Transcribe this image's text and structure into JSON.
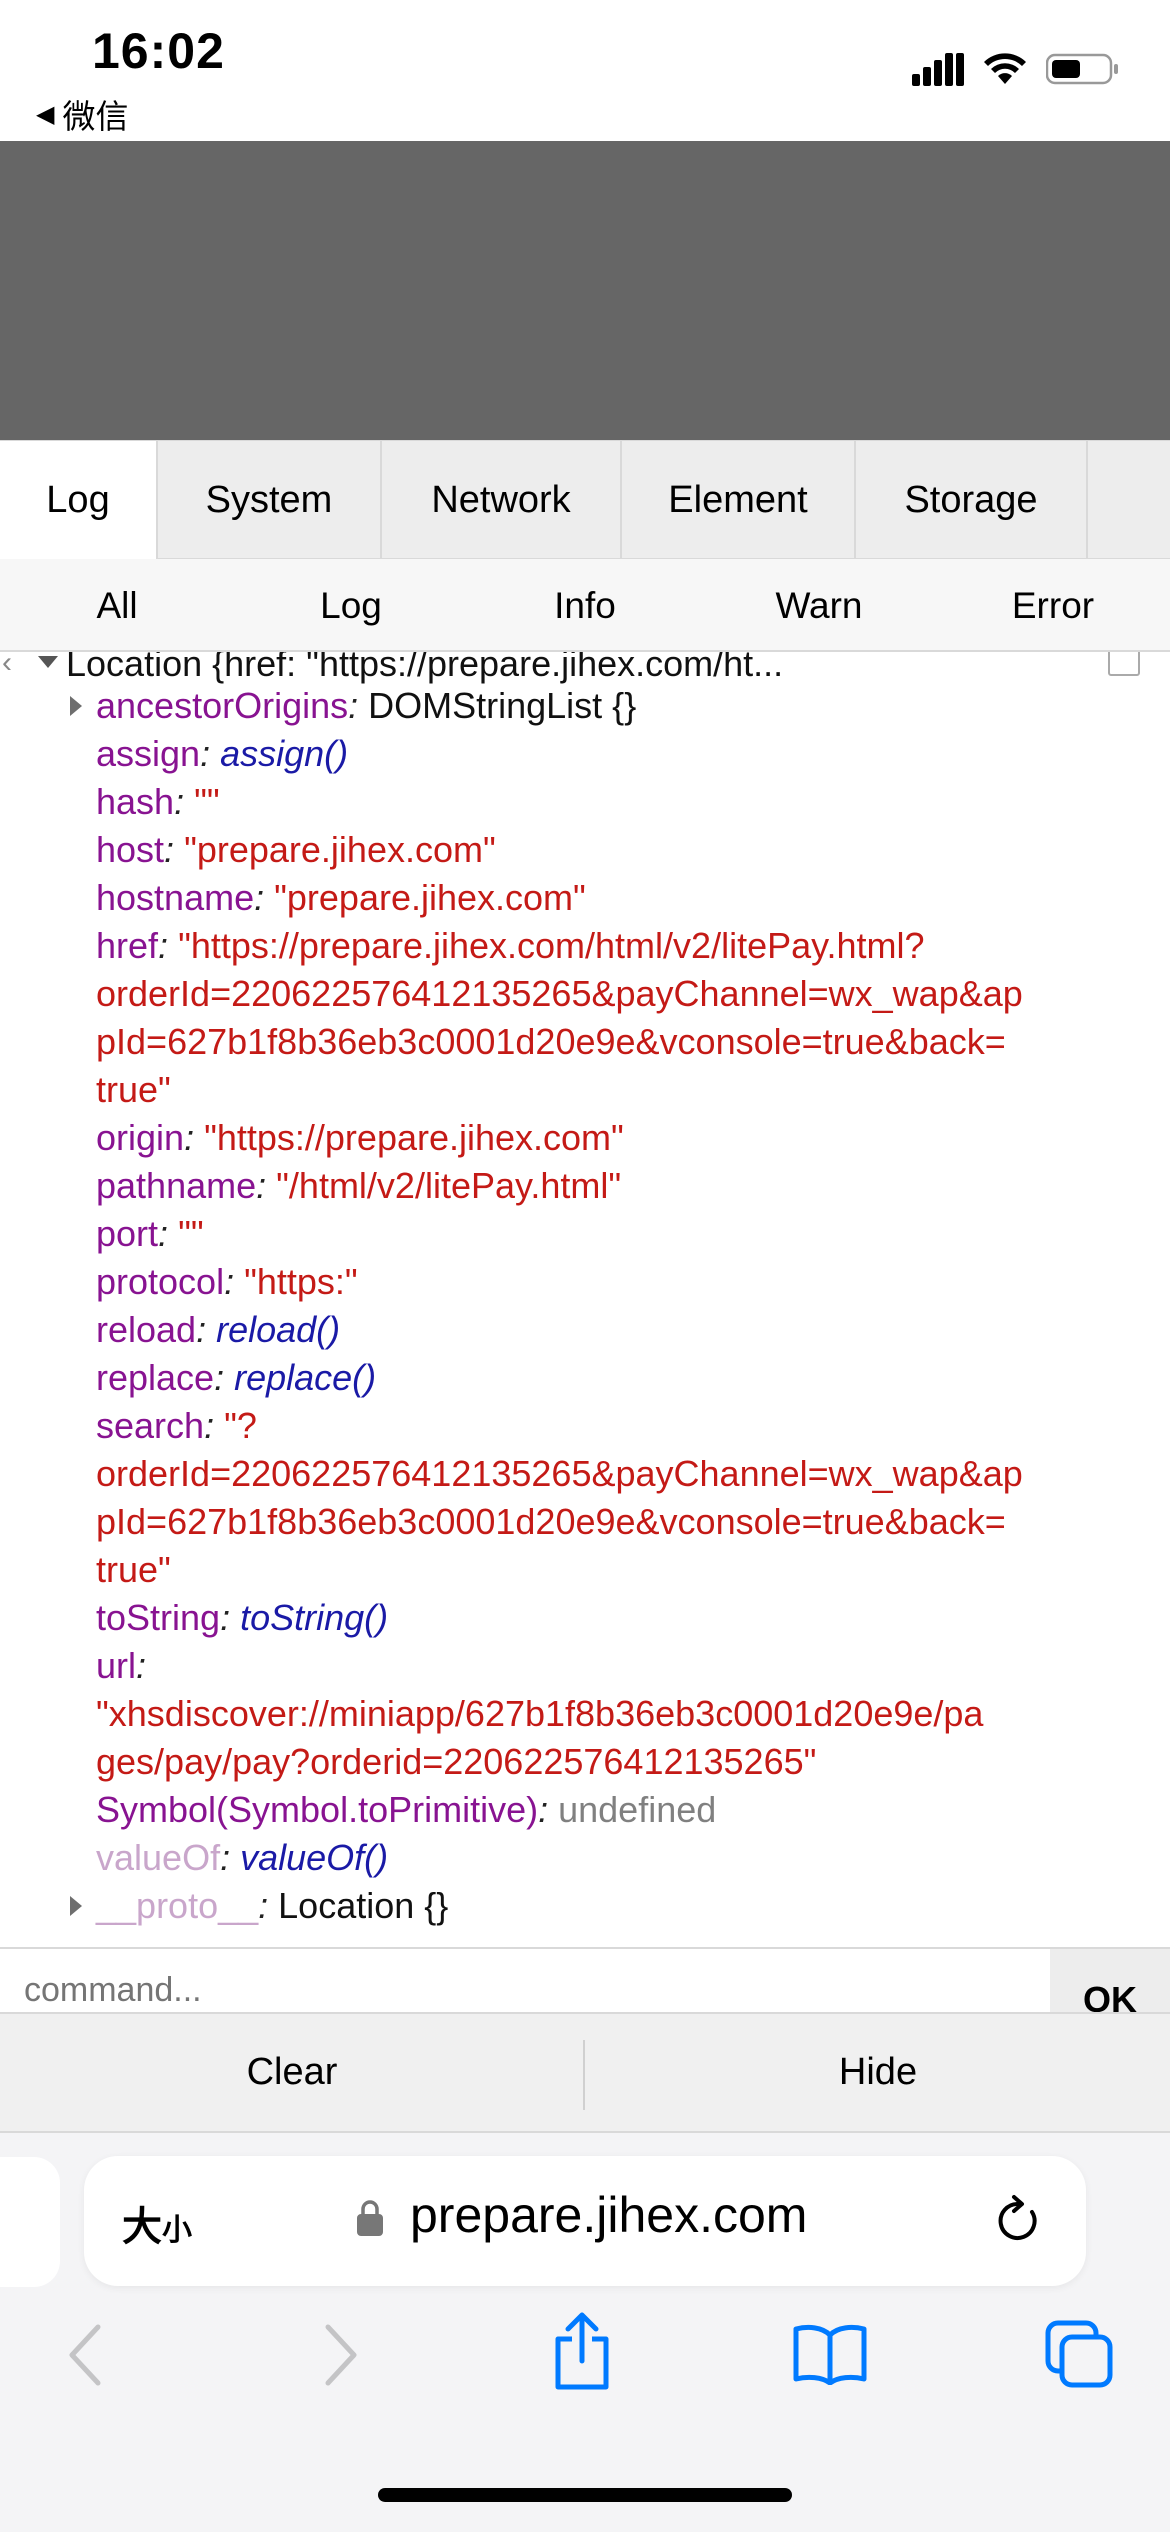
{
  "status_bar": {
    "time": "16:02",
    "back_app": "微信"
  },
  "tabs": [
    {
      "label": "Log"
    },
    {
      "label": "System"
    },
    {
      "label": "Network"
    },
    {
      "label": "Element"
    },
    {
      "label": "Storage"
    }
  ],
  "filters": [
    {
      "label": "All"
    },
    {
      "label": "Log"
    },
    {
      "label": "Info"
    },
    {
      "label": "Warn"
    },
    {
      "label": "Error"
    }
  ],
  "log": {
    "header": "Location {href: \"https://prepare.jihex.com/ht...",
    "props": {
      "ancestorOrigins": {
        "key": "ancestorOrigins",
        "value": "DOMStringList {}"
      },
      "assign": {
        "key": "assign",
        "value": "assign()"
      },
      "hash": {
        "key": "hash",
        "value": "\"\""
      },
      "host": {
        "key": "host",
        "value": "\"prepare.jihex.com\""
      },
      "hostname": {
        "key": "hostname",
        "value": "\"prepare.jihex.com\""
      },
      "href": {
        "key": "href",
        "value_lines": [
          "\"https://prepare.jihex.com/html/v2/litePay.html?",
          "orderId=220622576412135265&payChannel=wx_wap&ap",
          "pId=627b1f8b36eb3c0001d20e9e&vconsole=true&back=",
          "true\""
        ]
      },
      "origin": {
        "key": "origin",
        "value": "\"https://prepare.jihex.com\""
      },
      "pathname": {
        "key": "pathname",
        "value": "\"/html/v2/litePay.html\""
      },
      "port": {
        "key": "port",
        "value": "\"\""
      },
      "protocol": {
        "key": "protocol",
        "value": "\"https:\""
      },
      "reload": {
        "key": "reload",
        "value": "reload()"
      },
      "replace": {
        "key": "replace",
        "value": "replace()"
      },
      "search": {
        "key": "search",
        "value_lines": [
          "\"?",
          "orderId=220622576412135265&payChannel=wx_wap&ap",
          "pId=627b1f8b36eb3c0001d20e9e&vconsole=true&back=",
          "true\""
        ]
      },
      "toString": {
        "key": "toString",
        "value": "toString()"
      },
      "url": {
        "key": "url",
        "value_lines": [
          "\"xhsdiscover://miniapp/627b1f8b36eb3c0001d20e9e/pa",
          "ges/pay/pay?orderid=220622576412135265\""
        ]
      },
      "symbol": {
        "key": "Symbol(Symbol.toPrimitive)",
        "value": "undefined"
      },
      "valueOf": {
        "key": "valueOf",
        "value": "valueOf()"
      },
      "proto": {
        "key": "__proto__",
        "value": "Location {}"
      }
    }
  },
  "command": {
    "placeholder": "command...",
    "ok_label": "OK"
  },
  "actions": {
    "clear_label": "Clear",
    "hide_label": "Hide"
  },
  "safari": {
    "text_size_big": "大",
    "text_size_small": "小",
    "url": "prepare.jihex.com"
  },
  "colors": {
    "accent": "#007aff",
    "key": "#881391",
    "string": "#c41a16",
    "function": "#1a1aa6"
  }
}
